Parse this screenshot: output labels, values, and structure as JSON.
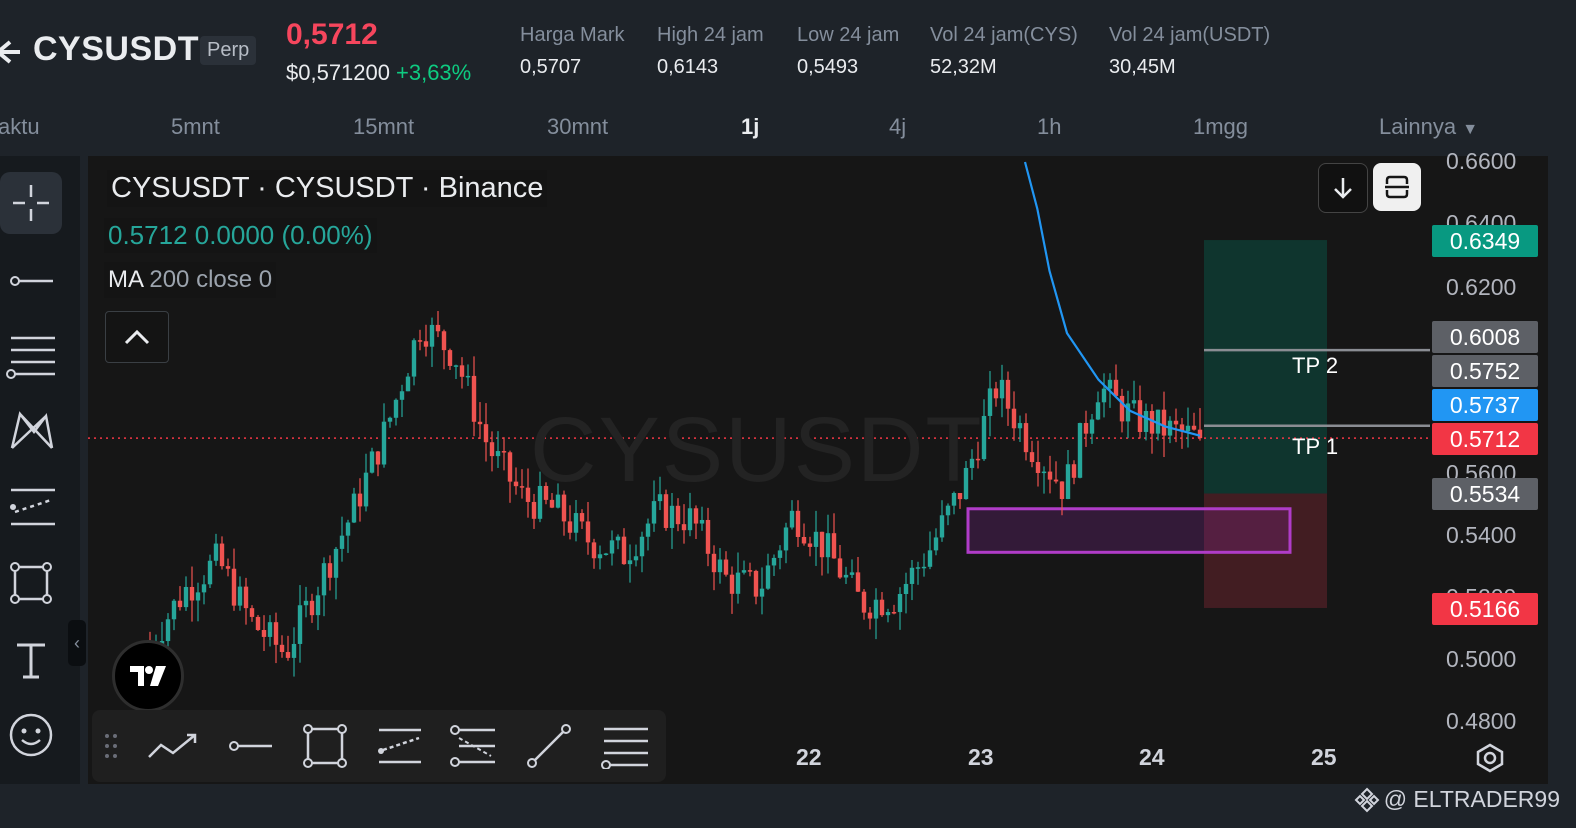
{
  "header": {
    "symbol": "CYSUSDT",
    "contract_type": "Perp",
    "last_price": "0,5712",
    "usd_price": "$0,571200",
    "change": "+3,63%",
    "stats": [
      {
        "label": "Harga Mark",
        "value": "0,5707"
      },
      {
        "label": "High 24 jam",
        "value": "0,6143"
      },
      {
        "label": "Low 24 jam",
        "value": "0,5493"
      },
      {
        "label": "Vol 24 jam(CYS)",
        "value": "52,32M"
      },
      {
        "label": "Vol 24 jam(USDT)",
        "value": "30,45M"
      }
    ]
  },
  "timeframes": {
    "items": [
      {
        "label": "aktu"
      },
      {
        "label": "5mnt"
      },
      {
        "label": "15mnt"
      },
      {
        "label": "30mnt"
      },
      {
        "label": "1j",
        "active": true
      },
      {
        "label": "4j"
      },
      {
        "label": "1h"
      },
      {
        "label": "1mgg"
      },
      {
        "label": "Lainnya"
      }
    ]
  },
  "chart": {
    "title": "CYSUSDT · CYSUSDT · Binance",
    "ohlc_line": "0.5712  0.0000 (0.00%)",
    "ma_name": "MA",
    "ma_params": "200 close 0",
    "watermark": "CYSUSDT",
    "price_ticks": [
      "0.6600",
      "0.6400",
      "0.6200",
      "0.5600",
      "0.5400",
      "0.5200",
      "0.5000",
      "0.4800"
    ],
    "price_labels": [
      {
        "value": "0.6349",
        "color": "#089981"
      },
      {
        "value": "0.6008",
        "color": "#5d6066"
      },
      {
        "value": "0.5752",
        "color": "#5d6066"
      },
      {
        "value": "0.5737",
        "color": "#2196f3"
      },
      {
        "value": "0.5712",
        "color": "#f23645"
      },
      {
        "value": "0.5534",
        "color": "#5d6066"
      },
      {
        "value": "0.5166",
        "color": "#f23645"
      }
    ],
    "tp_labels": [
      "TP 2",
      "TP 1"
    ],
    "dates": [
      "22",
      "23",
      "24",
      "25"
    ],
    "colors": {
      "up": "#26a69a",
      "down": "#ef5350",
      "ma": "#2196f3",
      "zone": "#9c27b0"
    }
  },
  "left_toolbar": [
    "crosshair-icon",
    "horizontal-line-icon",
    "fib-retracement-icon",
    "pattern-icon",
    "prediction-icon",
    "rectangle-icon",
    "text-icon",
    "emoji-icon"
  ],
  "bottom_toolbar": [
    "trend-line-icon",
    "horizontal-ray-icon",
    "rectangle-icon",
    "parallel-channel-icon",
    "fib-levels-icon",
    "line-segment-icon",
    "fib-retracement-icon"
  ],
  "credit": "@ ELTRADER99",
  "chart_data": {
    "type": "candlestick",
    "title": "CYSUSDT · CYSUSDT · Binance",
    "xlabel": "",
    "ylabel": "",
    "x_tick_labels": [
      "22",
      "23",
      "24",
      "25"
    ],
    "ylim": [
      0.48,
      0.66
    ],
    "y_tick_labels": [
      "0.6600",
      "0.6400",
      "0.6200",
      "0.5600",
      "0.5400",
      "0.5200",
      "0.5000",
      "0.4800"
    ],
    "last_price": 0.5712,
    "marked_levels": [
      0.6349,
      0.6008,
      0.5752,
      0.5737,
      0.5712,
      0.5534,
      0.5166
    ],
    "take_profit_levels": [
      {
        "name": "TP 2",
        "price": 0.5752
      },
      {
        "name": "TP 1",
        "price": 0.5737
      }
    ],
    "position": {
      "target": 0.6349,
      "entry": 0.5534,
      "stop": 0.5166
    },
    "zone": {
      "top": 0.5485,
      "bottom": 0.5345
    },
    "series": [
      {
        "name": "CYSUSDT",
        "close_path": [
          0.505,
          0.522,
          0.532,
          0.512,
          0.502,
          0.525,
          0.548,
          0.575,
          0.608,
          0.598,
          0.568,
          0.552,
          0.548,
          0.538,
          0.534,
          0.548,
          0.545,
          0.526,
          0.523,
          0.547,
          0.535,
          0.518,
          0.52,
          0.535,
          0.556,
          0.588,
          0.569,
          0.555,
          0.588,
          0.578,
          0.574,
          0.5712
        ]
      },
      {
        "name": "MA 200",
        "points": [
          [
            0.66,
            0
          ],
          [
            0.645,
            0.07
          ],
          [
            0.625,
            0.14
          ],
          [
            0.605,
            0.24
          ],
          [
            0.59,
            0.42
          ],
          [
            0.58,
            0.6
          ],
          [
            0.575,
            0.8
          ],
          [
            0.572,
            1
          ]
        ]
      }
    ]
  }
}
